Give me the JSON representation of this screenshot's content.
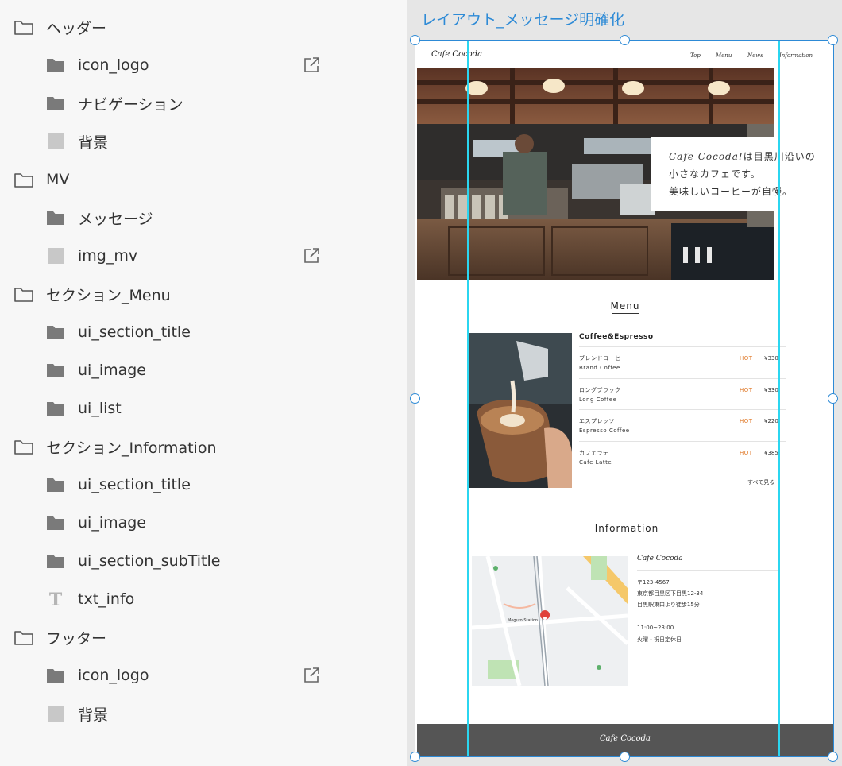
{
  "layers": [
    {
      "label": "ヘッダー",
      "level": 0,
      "icon": "folder-outline-icon",
      "link": false
    },
    {
      "label": "icon_logo",
      "level": 1,
      "icon": "folder-filled-icon",
      "link": true
    },
    {
      "label": "ナビゲーション",
      "level": 1,
      "icon": "folder-filled-icon",
      "link": false
    },
    {
      "label": "背景",
      "level": 1,
      "icon": "rectangle-icon",
      "link": false
    },
    {
      "label": "MV",
      "level": 0,
      "icon": "folder-outline-icon",
      "link": false
    },
    {
      "label": "メッセージ",
      "level": 1,
      "icon": "folder-filled-icon",
      "link": false
    },
    {
      "label": "img_mv",
      "level": 1,
      "icon": "rectangle-icon",
      "link": true
    },
    {
      "label": "セクション_Menu",
      "level": 0,
      "icon": "folder-outline-icon",
      "link": false
    },
    {
      "label": "ui_section_title",
      "level": 1,
      "icon": "folder-filled-icon",
      "link": false
    },
    {
      "label": "ui_image",
      "level": 1,
      "icon": "folder-filled-icon",
      "link": false
    },
    {
      "label": "ui_list",
      "level": 1,
      "icon": "folder-filled-icon",
      "link": false
    },
    {
      "label": "セクション_Information",
      "level": 0,
      "icon": "folder-outline-icon",
      "link": false
    },
    {
      "label": "ui_section_title",
      "level": 1,
      "icon": "folder-filled-icon",
      "link": false
    },
    {
      "label": "ui_image",
      "level": 1,
      "icon": "folder-filled-icon",
      "link": false
    },
    {
      "label": "ui_section_subTitle",
      "level": 1,
      "icon": "folder-filled-icon",
      "link": false
    },
    {
      "label": "txt_info",
      "level": 1,
      "icon": "text-icon",
      "link": false
    },
    {
      "label": "フッター",
      "level": 0,
      "icon": "folder-outline-icon",
      "link": false
    },
    {
      "label": "icon_logo",
      "level": 1,
      "icon": "folder-filled-icon",
      "link": true
    },
    {
      "label": "背景",
      "level": 1,
      "icon": "rectangle-icon",
      "link": false
    }
  ],
  "artboard": {
    "title": "レイアウト_メッセージ明確化",
    "accent_color": "#2d8ad6",
    "guide_color": "#2bd6f0"
  },
  "site": {
    "logo": "Cafe Cocoda",
    "nav": [
      "Top",
      "Menu",
      "News",
      "Information"
    ],
    "message": [
      {
        "brand": "Cafe Cocoda!",
        "rest": "は目黒川沿いの"
      },
      {
        "text": "小さなカフェです。"
      },
      {
        "text": "美味しいコーヒーが自慢。"
      }
    ],
    "menu": {
      "title": "Menu",
      "category": "Coffee&Espresso",
      "items": [
        {
          "ja": "ブレンドコーヒー",
          "en": "Brand Coffee",
          "tag": "HOT",
          "price": "¥330"
        },
        {
          "ja": "ロングブラック",
          "en": "Long Coffee",
          "tag": "HOT",
          "price": "¥330"
        },
        {
          "ja": "エスプレッソ",
          "en": "Espresso Coffee",
          "tag": "HOT",
          "price": "¥220"
        },
        {
          "ja": "カフェラテ",
          "en": "Cafe Latte",
          "tag": "HOT",
          "price": "¥385"
        }
      ],
      "see_all": "すべて見る"
    },
    "information": {
      "title": "Information",
      "name": "Cafe Cocoda",
      "lines": [
        "〒123-4567",
        "東京都目黒区下目黒12-34",
        "目黒駅東口より徒歩15分",
        "",
        "11:00~23:00",
        "火曜・祝日定休日"
      ],
      "map_label": "Meguro Station"
    },
    "footer": "Cafe Cocoda"
  }
}
